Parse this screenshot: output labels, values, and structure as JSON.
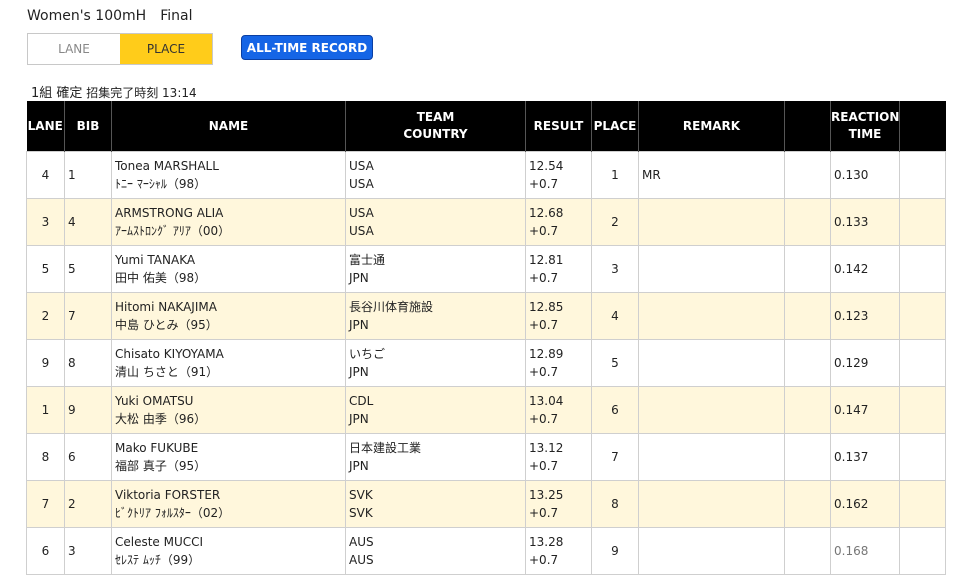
{
  "event_title": "Women's 100mH　Final",
  "toggle": {
    "lane_label": "LANE",
    "place_label": "PLACE",
    "active": "place"
  },
  "all_time_record_label": "ALL-TIME RECORD",
  "heat": {
    "group": "1組 確定",
    "call_time": "招集完了時刻 13:14"
  },
  "columns": {
    "lane": "LANE",
    "bib": "BIB",
    "name": "NAME",
    "team_line1": "TEAM",
    "team_line2": "COUNTRY",
    "result": "RESULT",
    "place": "PLACE",
    "remark": "REMARK",
    "reaction_line1": "REACTION",
    "reaction_line2": "TIME"
  },
  "rows": [
    {
      "lane": "4",
      "bib": "1",
      "name_en": "Tonea MARSHALL",
      "name_jp": "ﾄﾆｰ ﾏｰｼｬﾙ（98）",
      "team": "USA",
      "country": "USA",
      "time": "12.54",
      "wind": "+0.7",
      "place": "1",
      "remark": "MR",
      "reaction": "0.130"
    },
    {
      "lane": "3",
      "bib": "4",
      "name_en": "ARMSTRONG ALIA",
      "name_jp": "ｱｰﾑｽﾄﾛﾝｸﾞ ｱﾘｱ（00）",
      "team": "USA",
      "country": "USA",
      "time": "12.68",
      "wind": "+0.7",
      "place": "2",
      "remark": "",
      "reaction": "0.133"
    },
    {
      "lane": "5",
      "bib": "5",
      "name_en": "Yumi TANAKA",
      "name_jp": "田中 佑美（98）",
      "team": "富士通",
      "country": "JPN",
      "time": "12.81",
      "wind": "+0.7",
      "place": "3",
      "remark": "",
      "reaction": "0.142"
    },
    {
      "lane": "2",
      "bib": "7",
      "name_en": "Hitomi NAKAJIMA",
      "name_jp": "中島 ひとみ（95）",
      "team": "長谷川体育施設",
      "country": "JPN",
      "time": "12.85",
      "wind": "+0.7",
      "place": "4",
      "remark": "",
      "reaction": "0.123"
    },
    {
      "lane": "9",
      "bib": "8",
      "name_en": "Chisato KIYOYAMA",
      "name_jp": "清山 ちさと（91）",
      "team": "いちご",
      "country": "JPN",
      "time": "12.89",
      "wind": "+0.7",
      "place": "5",
      "remark": "",
      "reaction": "0.129"
    },
    {
      "lane": "1",
      "bib": "9",
      "name_en": "Yuki OMATSU",
      "name_jp": "大松 由季（96）",
      "team": "CDL",
      "country": "JPN",
      "time": "13.04",
      "wind": "+0.7",
      "place": "6",
      "remark": "",
      "reaction": "0.147"
    },
    {
      "lane": "8",
      "bib": "6",
      "name_en": "Mako FUKUBE",
      "name_jp": "福部 真子（95）",
      "team": "日本建設工業",
      "country": "JPN",
      "time": "13.12",
      "wind": "+0.7",
      "place": "7",
      "remark": "",
      "reaction": "0.137"
    },
    {
      "lane": "7",
      "bib": "2",
      "name_en": "Viktoria FORSTER",
      "name_jp": "ﾋﾞｸﾄﾘｱ ﾌｫﾙｽﾀｰ（02）",
      "team": "SVK",
      "country": "SVK",
      "time": "13.25",
      "wind": "+0.7",
      "place": "8",
      "remark": "",
      "reaction": "0.162"
    },
    {
      "lane": "6",
      "bib": "3",
      "name_en": "Celeste MUCCI",
      "name_jp": "ｾﾚｽﾃ ﾑｯﾁ（99）",
      "team": "AUS",
      "country": "AUS",
      "time": "13.28",
      "wind": "+0.7",
      "place": "9",
      "remark": "",
      "reaction": "0.168"
    }
  ]
}
